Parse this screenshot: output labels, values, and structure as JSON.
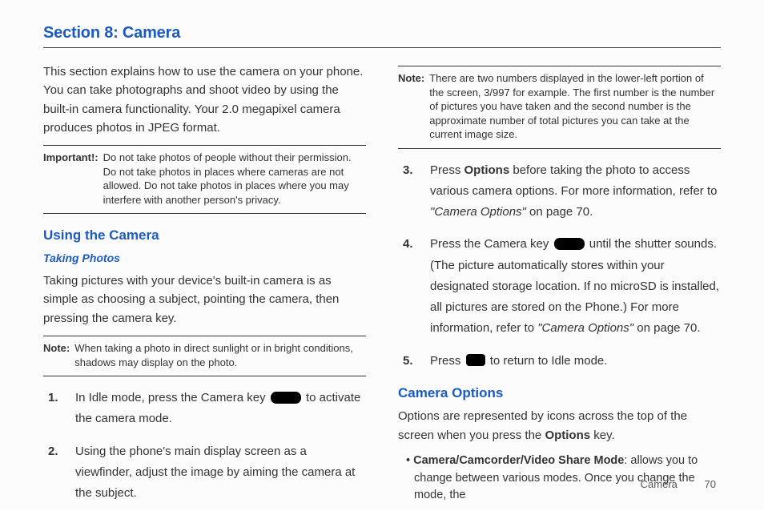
{
  "section_title": "Section 8: Camera",
  "left": {
    "intro": "This section explains how to use the camera on your phone. You can take photographs and shoot video by using the built-in camera functionality. Your 2.0 megapixel camera produces photos in JPEG format.",
    "important_label": "Important!:",
    "important_text": "Do not take photos of people without their permission. Do not take photos in places where cameras are not allowed. Do not take photos in places where you may interfere with another person's privacy.",
    "heading_using": "Using the Camera",
    "sub_taking": "Taking Photos",
    "taking_body": "Taking pictures with your device's built-in camera is as simple as choosing a subject, pointing the camera, then pressing the camera key.",
    "note1_label": "Note:",
    "note1_text": "When taking a photo in direct sunlight or in bright conditions, shadows may display on the photo.",
    "step1_num": "1.",
    "step1_a": "In Idle mode, press the Camera key ",
    "step1_b": " to activate the camera mode.",
    "step2_num": "2.",
    "step2": "Using the phone's main display screen as a viewfinder, adjust the image by aiming the camera at the subject."
  },
  "right": {
    "note2_label": "Note:",
    "note2_text": "There are two numbers displayed in the lower-left portion of the screen, 3/997 for example. The first number is the number of pictures you have taken and the second number is the approximate number of total pictures you can take at the current image size.",
    "step3_num": "3.",
    "step3_a": "Press ",
    "step3_options": "Options",
    "step3_b": " before taking the photo to access various camera options. For more information, refer to ",
    "step3_ref": "\"Camera Options\"",
    "step3_c": "  on page 70.",
    "step4_num": "4.",
    "step4_a": "Press the Camera key ",
    "step4_b": " until the shutter sounds. (The picture automatically stores within your designated storage location. If no microSD is installed, all pictures are stored on the Phone.) For more information, refer to ",
    "step4_ref": "\"Camera Options\"",
    "step4_c": "  on page 70.",
    "step5_num": "5.",
    "step5_a": "Press ",
    "step5_b": " to return to Idle mode.",
    "heading_options": "Camera Options",
    "options_body_a": "Options are represented by icons across the top of the screen when you press the ",
    "options_body_key": "Options",
    "options_body_b": " key.",
    "bullet1_bold": "Camera/Camcorder/Video Share Mode",
    "bullet1_rest": ": allows you to change between various modes. Once you change the mode, the"
  },
  "footer": {
    "label": "Camera",
    "page": "70"
  }
}
